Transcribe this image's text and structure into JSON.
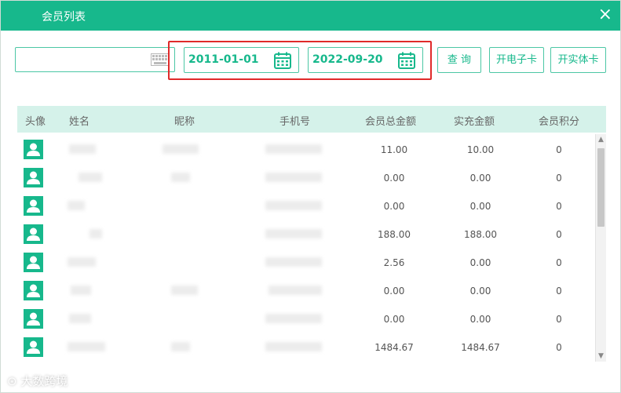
{
  "dialog": {
    "title": "会员列表",
    "close_icon": "×"
  },
  "toolbar": {
    "search_value": "",
    "start_date": "2011-01-01",
    "end_date": "2022-09-20",
    "query_button": "查 询",
    "electronic_card_button": "开电子卡",
    "physical_card_button": "开实体卡"
  },
  "table": {
    "headers": [
      "头像",
      "姓名",
      "昵称",
      "手机号",
      "会员总金额",
      "实充金额",
      "会员积分"
    ],
    "rows": [
      {
        "total": "11.00",
        "recharge": "10.00",
        "points": "0"
      },
      {
        "total": "0.00",
        "recharge": "0.00",
        "points": "0"
      },
      {
        "total": "0.00",
        "recharge": "0.00",
        "points": "0"
      },
      {
        "total": "188.00",
        "recharge": "188.00",
        "points": "0"
      },
      {
        "total": "2.56",
        "recharge": "0.00",
        "points": "0"
      },
      {
        "total": "0.00",
        "recharge": "0.00",
        "points": "0"
      },
      {
        "total": "0.00",
        "recharge": "0.00",
        "points": "0"
      },
      {
        "total": "1484.67",
        "recharge": "1484.67",
        "points": "0"
      }
    ]
  },
  "watermark": "大数跨境",
  "colors": {
    "accent": "#17b88c",
    "header_bg": "#d5f2ea",
    "highlight": "#e02a2a"
  }
}
